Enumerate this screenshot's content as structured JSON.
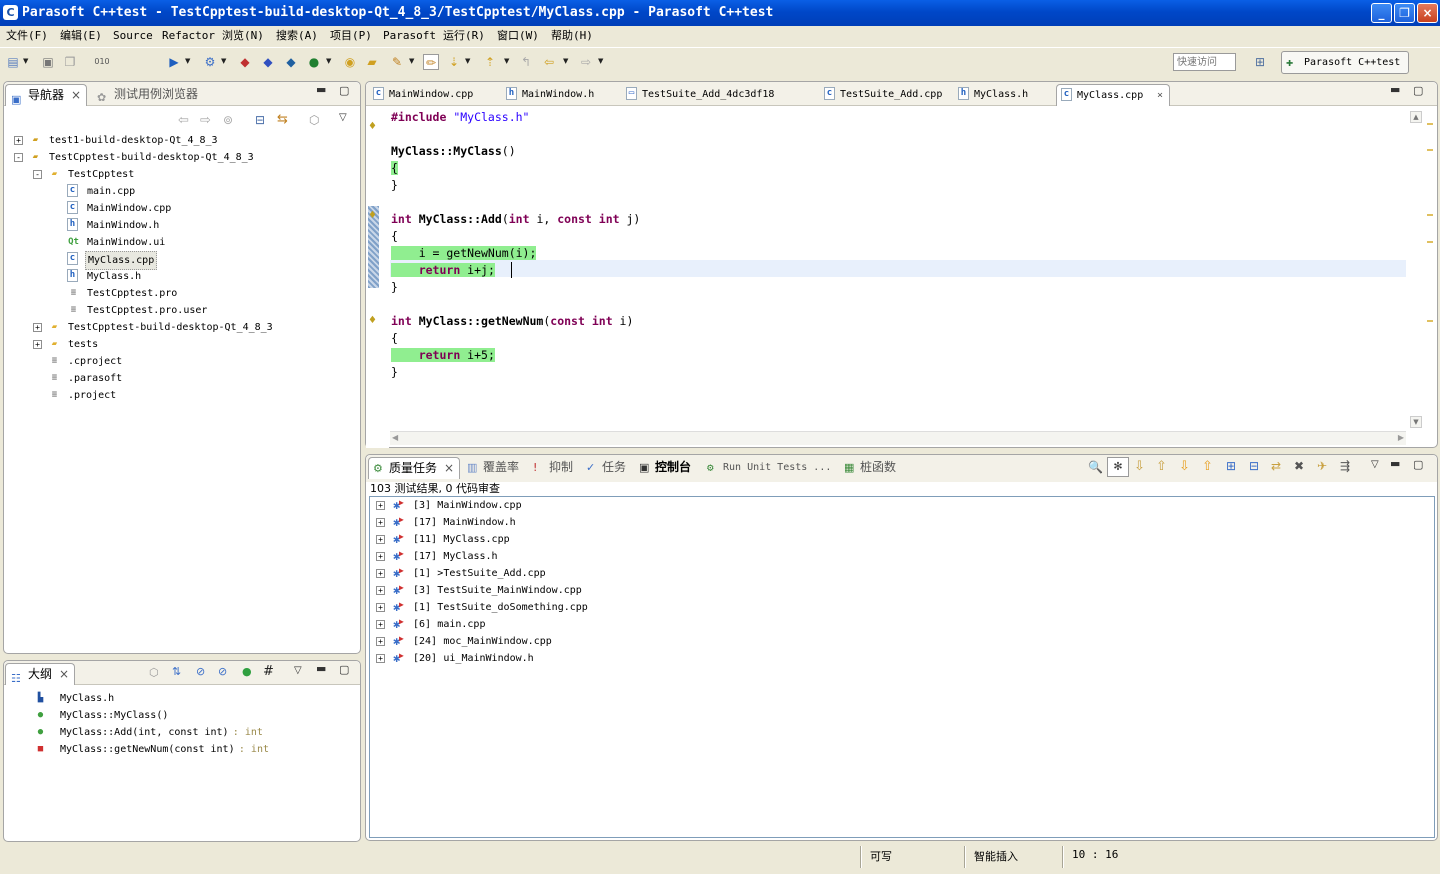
{
  "window": {
    "title": "Parasoft C++test - TestCpptest-build-desktop-Qt_4_8_3/TestCpptest/MyClass.cpp - Parasoft C++test",
    "controls": [
      "_",
      "❐",
      "×"
    ]
  },
  "menu": [
    "文件(F)",
    "编辑(E)",
    "Source",
    "Refactor",
    "浏览(N)",
    "搜索(A)",
    "项目(P)",
    "Parasoft",
    "运行(R)",
    "窗口(W)",
    "帮助(H)"
  ],
  "toolbar": {
    "quick_access_placeholder": "快速访问",
    "perspective_label": "Parasoft C++test"
  },
  "navigator": {
    "tabs": [
      "导航器",
      "测试用例浏览器"
    ],
    "tree": [
      {
        "label": "test1-build-desktop-Qt_4_8_3",
        "icon": "project-icon",
        "level": 0,
        "toggle": "+"
      },
      {
        "label": "TestCpptest-build-desktop-Qt_4_8_3",
        "icon": "project-icon",
        "level": 0,
        "toggle": "-"
      },
      {
        "label": "TestCpptest",
        "icon": "folder-icon",
        "level": 1,
        "toggle": "-"
      },
      {
        "label": "main.cpp",
        "icon": "cpp-file-icon",
        "level": 2,
        "toggle": ""
      },
      {
        "label": "MainWindow.cpp",
        "icon": "cpp-file-icon",
        "level": 2,
        "toggle": ""
      },
      {
        "label": "MainWindow.h",
        "icon": "header-file-icon",
        "level": 2,
        "toggle": ""
      },
      {
        "label": "MainWindow.ui",
        "icon": "qt-ui-file-icon",
        "level": 2,
        "toggle": ""
      },
      {
        "label": "MyClass.cpp",
        "icon": "cpp-file-icon",
        "level": 2,
        "toggle": "",
        "selected": true
      },
      {
        "label": "MyClass.h",
        "icon": "header-file-icon",
        "level": 2,
        "toggle": ""
      },
      {
        "label": "TestCpptest.pro",
        "icon": "text-file-icon",
        "level": 2,
        "toggle": ""
      },
      {
        "label": "TestCpptest.pro.user",
        "icon": "text-file-icon",
        "level": 2,
        "toggle": ""
      },
      {
        "label": "TestCpptest-build-desktop-Qt_4_8_3",
        "icon": "folder-icon",
        "level": 1,
        "toggle": "+"
      },
      {
        "label": "tests",
        "icon": "folder-icon",
        "level": 1,
        "toggle": "+"
      },
      {
        "label": ".cproject",
        "icon": "text-file-icon",
        "level": 1,
        "toggle": ""
      },
      {
        "label": ".parasoft",
        "icon": "text-file-icon",
        "level": 1,
        "toggle": ""
      },
      {
        "label": ".project",
        "icon": "text-file-icon",
        "level": 1,
        "toggle": ""
      }
    ]
  },
  "outline": {
    "tab": "大纲",
    "items": [
      {
        "label": "MyClass.h",
        "type": "",
        "icon": "include-icon"
      },
      {
        "label": "MyClass::MyClass()",
        "type": "",
        "icon": "method-icon"
      },
      {
        "label": "MyClass::Add(int, const int)",
        "type": " : int",
        "icon": "method-icon"
      },
      {
        "label": "MyClass::getNewNum(const int)",
        "type": " : int",
        "icon": "private-method-icon"
      }
    ]
  },
  "editor": {
    "tabs": [
      {
        "label": "MainWindow.cpp",
        "icon": "cpp-file-icon"
      },
      {
        "label": "MainWindow.h",
        "icon": "header-file-icon"
      },
      {
        "label": "TestSuite_Add_4dc3df18",
        "icon": "window-icon"
      },
      {
        "label": "TestSuite_Add.cpp",
        "icon": "cpp-file-icon"
      },
      {
        "label": "MyClass.h",
        "icon": "header-file-icon"
      },
      {
        "label": "MyClass.cpp",
        "icon": "cpp-file-icon",
        "active": true
      }
    ],
    "lines": [
      {
        "row": 0,
        "tokens": [
          {
            "t": "#include ",
            "c": "kw"
          },
          {
            "t": "\"MyClass.h\"",
            "c": "str"
          }
        ]
      },
      {
        "row": 2,
        "tokens": [
          {
            "t": "MyClass::MyClass",
            "c": "fn"
          },
          {
            "t": "()",
            "c": ""
          }
        ]
      },
      {
        "row": 3,
        "tokens": [
          {
            "t": "{",
            "c": "cov"
          }
        ]
      },
      {
        "row": 4,
        "tokens": [
          {
            "t": "}",
            "c": ""
          }
        ]
      },
      {
        "row": 6,
        "tokens": [
          {
            "t": "int",
            "c": "kw"
          },
          {
            "t": " ",
            "c": ""
          },
          {
            "t": "MyClass::Add",
            "c": "fn"
          },
          {
            "t": "(",
            "c": ""
          },
          {
            "t": "int",
            "c": "kw"
          },
          {
            "t": " i, ",
            "c": ""
          },
          {
            "t": "const",
            "c": "kw"
          },
          {
            "t": " ",
            "c": ""
          },
          {
            "t": "int",
            "c": "kw"
          },
          {
            "t": " j)",
            "c": ""
          }
        ]
      },
      {
        "row": 7,
        "tokens": [
          {
            "t": "{",
            "c": ""
          }
        ]
      },
      {
        "row": 8,
        "tokens": [
          {
            "t": "    i = getNewNum(i);",
            "c": "cov"
          }
        ]
      },
      {
        "row": 9,
        "tokens": [
          {
            "t": "    ",
            "c": "cov"
          },
          {
            "t": "return",
            "c": "kw cov"
          },
          {
            "t": " i+j;",
            "c": "cov"
          }
        ]
      },
      {
        "row": 10,
        "tokens": [
          {
            "t": "}",
            "c": ""
          }
        ]
      },
      {
        "row": 12,
        "tokens": [
          {
            "t": "int",
            "c": "kw"
          },
          {
            "t": " ",
            "c": ""
          },
          {
            "t": "MyClass::getNewNum",
            "c": "fn"
          },
          {
            "t": "(",
            "c": ""
          },
          {
            "t": "const",
            "c": "kw"
          },
          {
            "t": " ",
            "c": ""
          },
          {
            "t": "int",
            "c": "kw"
          },
          {
            "t": " i)",
            "c": ""
          }
        ]
      },
      {
        "row": 13,
        "tokens": [
          {
            "t": "{",
            "c": ""
          }
        ]
      },
      {
        "row": 14,
        "tokens": [
          {
            "t": "    ",
            "c": "cov"
          },
          {
            "t": "return",
            "c": "kw cov"
          },
          {
            "t": " i+5;",
            "c": "cov"
          }
        ]
      },
      {
        "row": 15,
        "tokens": [
          {
            "t": "}",
            "c": ""
          }
        ]
      }
    ]
  },
  "bottom": {
    "tabs": [
      {
        "label": "质量任务",
        "icon": "quality-tasks-icon",
        "active": true
      },
      {
        "label": "覆盖率",
        "icon": "coverage-icon"
      },
      {
        "label": "抑制",
        "icon": "suppression-icon"
      },
      {
        "label": "任务",
        "icon": "tasks-icon"
      },
      {
        "label": "控制台",
        "icon": "console-icon"
      },
      {
        "label": "Run Unit Tests ...",
        "icon": "run-tests-icon"
      },
      {
        "label": "桩函数",
        "icon": "stubs-icon"
      }
    ],
    "summary": "103 测试结果, 0 代码审查",
    "results": [
      {
        "count": "[3]",
        "file": "MainWindow.cpp"
      },
      {
        "count": "[17]",
        "file": "MainWindow.h"
      },
      {
        "count": "[11]",
        "file": "MyClass.cpp"
      },
      {
        "count": "[17]",
        "file": "MyClass.h"
      },
      {
        "count": "[1]",
        "file": ">TestSuite_Add.cpp"
      },
      {
        "count": "[3]",
        "file": "TestSuite_MainWindow.cpp"
      },
      {
        "count": "[1]",
        "file": "TestSuite_doSomething.cpp"
      },
      {
        "count": "[6]",
        "file": "main.cpp"
      },
      {
        "count": "[24]",
        "file": "moc_MainWindow.cpp"
      },
      {
        "count": "[20]",
        "file": "ui_MainWindow.h"
      }
    ]
  },
  "status": {
    "writable": "可写",
    "insert_mode": "智能插入",
    "position": "10 : 16"
  },
  "colors": {
    "title_blue": "#0047c8",
    "coverage_green": "#90ee90",
    "keyword": "#7f0055",
    "string": "#2a00ff"
  }
}
